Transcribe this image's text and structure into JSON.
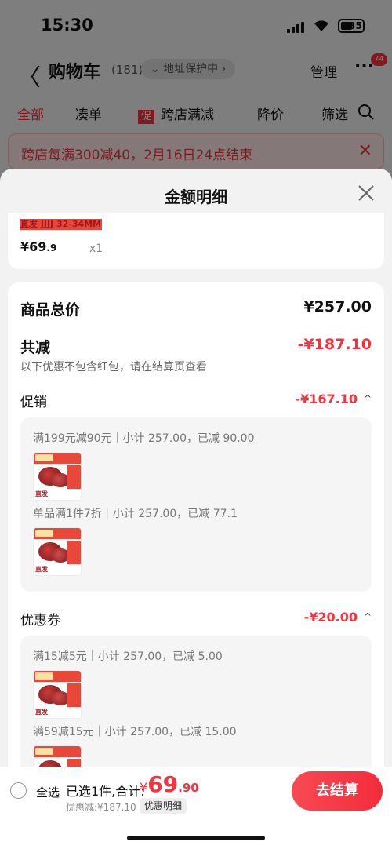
{
  "status": {
    "time": "15:30",
    "battery": "35"
  },
  "nav": {
    "back": "〈",
    "title": "购物车",
    "count": "(181)",
    "address": "⌄ 地址保护中 ›",
    "manage": "管理",
    "more": "···",
    "more_badge": "74"
  },
  "tabs": {
    "all": "全部",
    "coudan": "凑单",
    "promo_tag": "促",
    "cross_store": "跨店满减",
    "price_drop": "降价",
    "filter": "筛选"
  },
  "banner": {
    "text": "跨店每满300减40，2月16日24点结束",
    "close": "✕"
  },
  "sheet": {
    "title": "金额明细",
    "item": {
      "brand": "直发 JJJJ 32-34MM",
      "price_int": "¥69",
      "price_dec": ".9",
      "qty": "x1"
    },
    "total_label": "商品总价",
    "total_value": "¥257.00",
    "reduce_label": "共减",
    "reduce_value": "-¥187.10",
    "note": "以下优惠不包含红包，请在结算页查看",
    "promo": {
      "label": "促销",
      "value": "-¥167.10",
      "caret": "^",
      "rules": [
        "满199元减90元｜小计 257.00，已减 90.00",
        "单品满1件7折｜小计 257.00，已减 77.1"
      ]
    },
    "coupon": {
      "label": "优惠券",
      "value": "-¥20.00",
      "caret": "^",
      "rules": [
        "满15减5元｜小计 257.00，已减 5.00",
        "满59减15元｜小计 257.00，已减 15.00"
      ]
    },
    "thumb_brand": "直发"
  },
  "bottom": {
    "select_all": "全选",
    "selected": "已选1件,合计:",
    "currency": "¥",
    "amount_int": "69",
    "amount_dec": ".90",
    "discount": "优惠减:¥187.10",
    "detail": "优惠明细",
    "checkout": "去结算"
  },
  "colors": {
    "accent": "#f5333f",
    "background": "#f2f2f2"
  }
}
